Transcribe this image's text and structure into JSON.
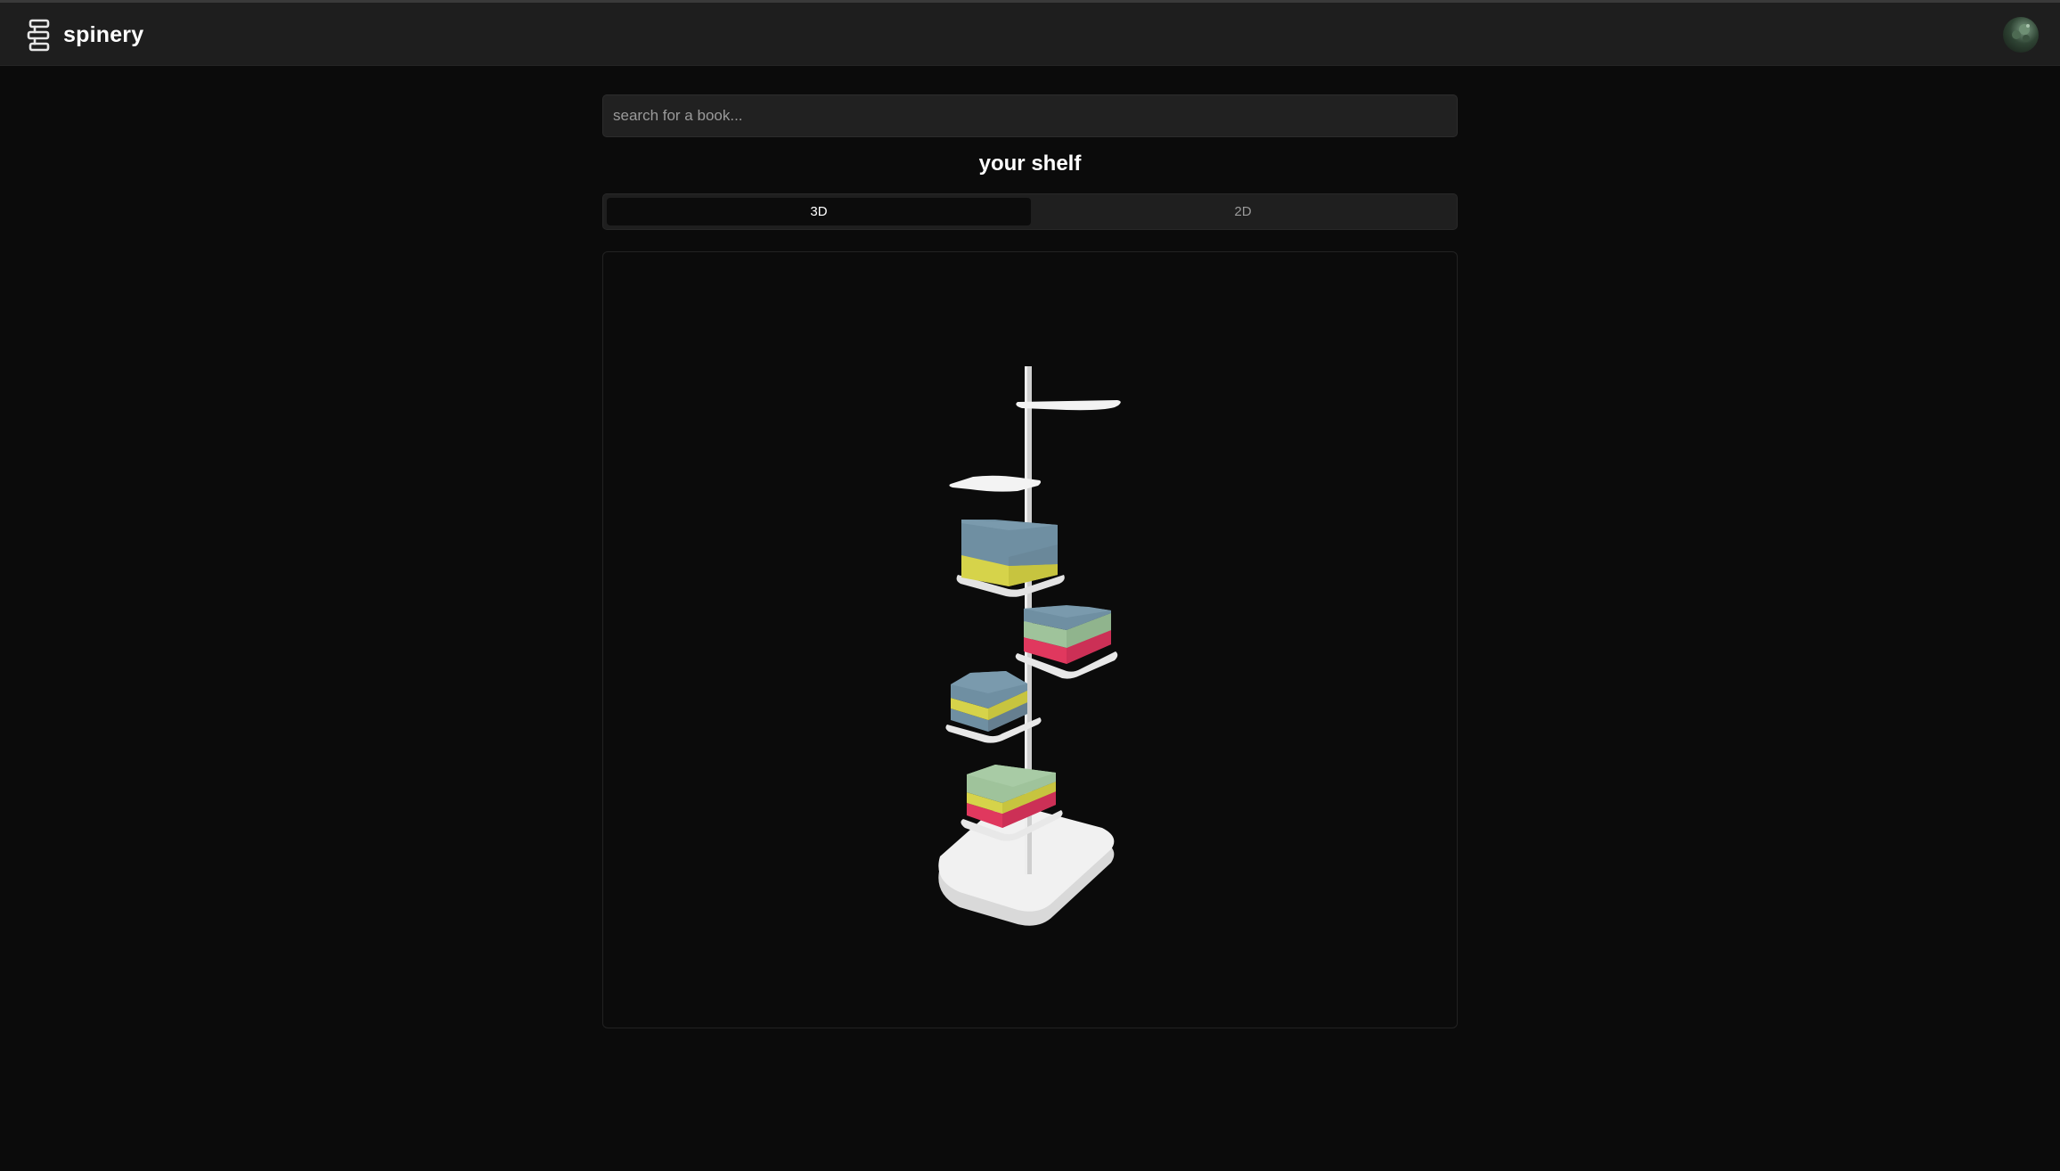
{
  "header": {
    "app_title": "spinery",
    "logo_icon": "books-stack-icon",
    "avatar_icon": "user-avatar"
  },
  "search": {
    "placeholder": "search for a book..."
  },
  "shelf": {
    "title": "your shelf",
    "tabs": [
      {
        "label": "3D",
        "active": true
      },
      {
        "label": "2D",
        "active": false
      }
    ]
  },
  "colors": {
    "background": "#0b0b0b",
    "topbar": "#1e1e1e",
    "book_blue": "#6f8fa2",
    "book_yellow": "#d6d34a",
    "book_green": "#9fc39b",
    "book_pink": "#e0385e",
    "shelf_white": "#f1f1f1"
  }
}
